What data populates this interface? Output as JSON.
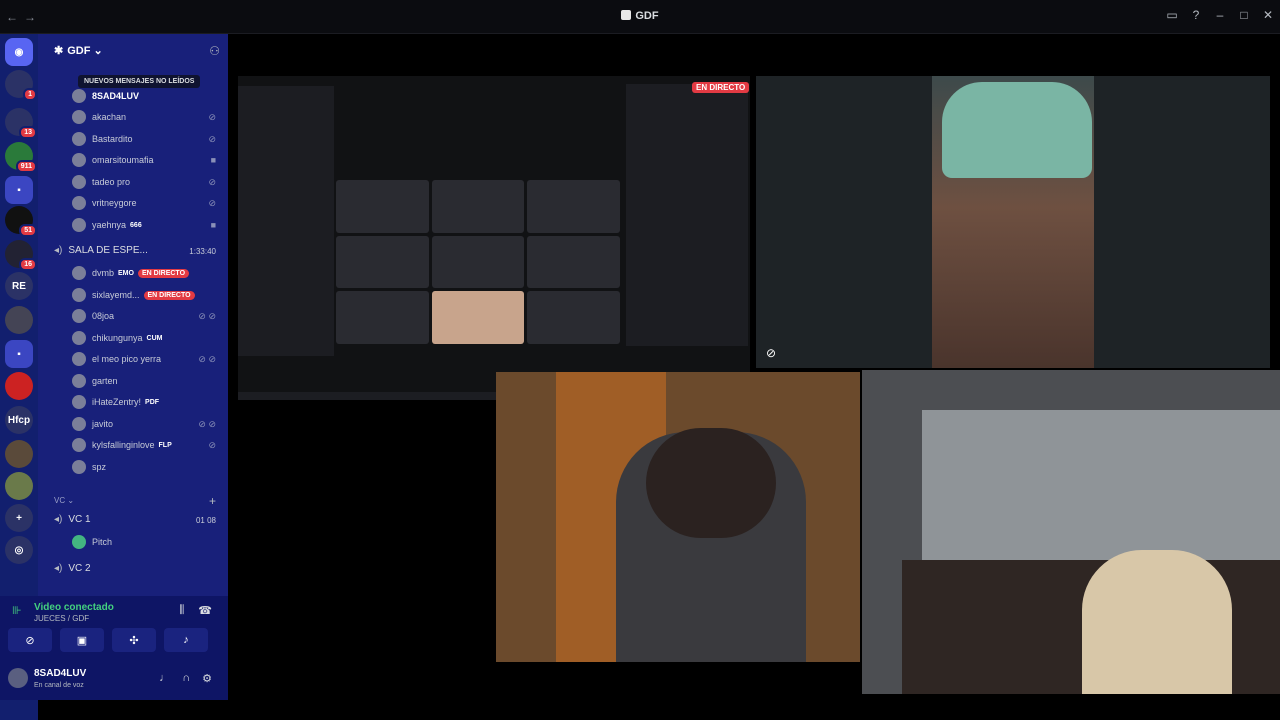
{
  "titlebar": {
    "title": "GDF"
  },
  "guilds": [
    {
      "badge": ""
    },
    {
      "badge": "1"
    },
    {
      "badge": "13"
    },
    {
      "badge": "911"
    },
    {
      "badge": ""
    },
    {
      "badge": "51"
    },
    {
      "badge": "16"
    },
    {
      "label": "RE",
      "badge": ""
    },
    {
      "badge": ""
    },
    {
      "badge": ""
    },
    {
      "badge": ""
    },
    {
      "label": "Hfcp",
      "badge": ""
    },
    {
      "badge": ""
    },
    {
      "badge": ""
    }
  ],
  "server": {
    "name": "GDF"
  },
  "tooltip": "NUEVOS MENSAJES NO LEÍDOS",
  "members_top": [
    {
      "name": "8SAD4LUV"
    },
    {
      "name": "akachan"
    },
    {
      "name": "Bastardito"
    },
    {
      "name": "omarsitoumafia"
    },
    {
      "name": "tadeo pro"
    },
    {
      "name": "vritneygore"
    },
    {
      "name": "yaehnya",
      "tag": "666"
    }
  ],
  "waiting_room": {
    "name": "SALA DE ESPE...",
    "time": "1:33:40"
  },
  "members_wait": [
    {
      "name": "dvmb",
      "tag": "EMO",
      "live": "EN DIRECTO"
    },
    {
      "name": "sixlayemd...",
      "live": "EN DIRECTO"
    },
    {
      "name": "08joa"
    },
    {
      "name": "chikungunya",
      "tag": "CUM"
    },
    {
      "name": "el meo pico yerra"
    },
    {
      "name": "garten"
    },
    {
      "name": "iHateZentry!",
      "tag": "PDF"
    },
    {
      "name": "javito"
    },
    {
      "name": "kylsfallinginlove",
      "tag": "FLP"
    },
    {
      "name": "spz"
    }
  ],
  "category": {
    "name": "VC"
  },
  "vc1": {
    "name": "VC 1",
    "count_a": "01",
    "count_b": "08"
  },
  "vc1_members": [
    {
      "name": "Pitch"
    }
  ],
  "vc2": {
    "name": "VC 2"
  },
  "voice": {
    "status": "Video conectado",
    "channel": "JUECES / GDF"
  },
  "user": {
    "name": "8SAD4LUV",
    "status": "En canal de voz"
  },
  "stage": {
    "screenshare_live": "EN DIRECTO"
  },
  "colors": {
    "sidebar": "#18207a",
    "guild_bar": "#121f6e",
    "live_badge": "#e23a43",
    "connected": "#43d17f"
  }
}
